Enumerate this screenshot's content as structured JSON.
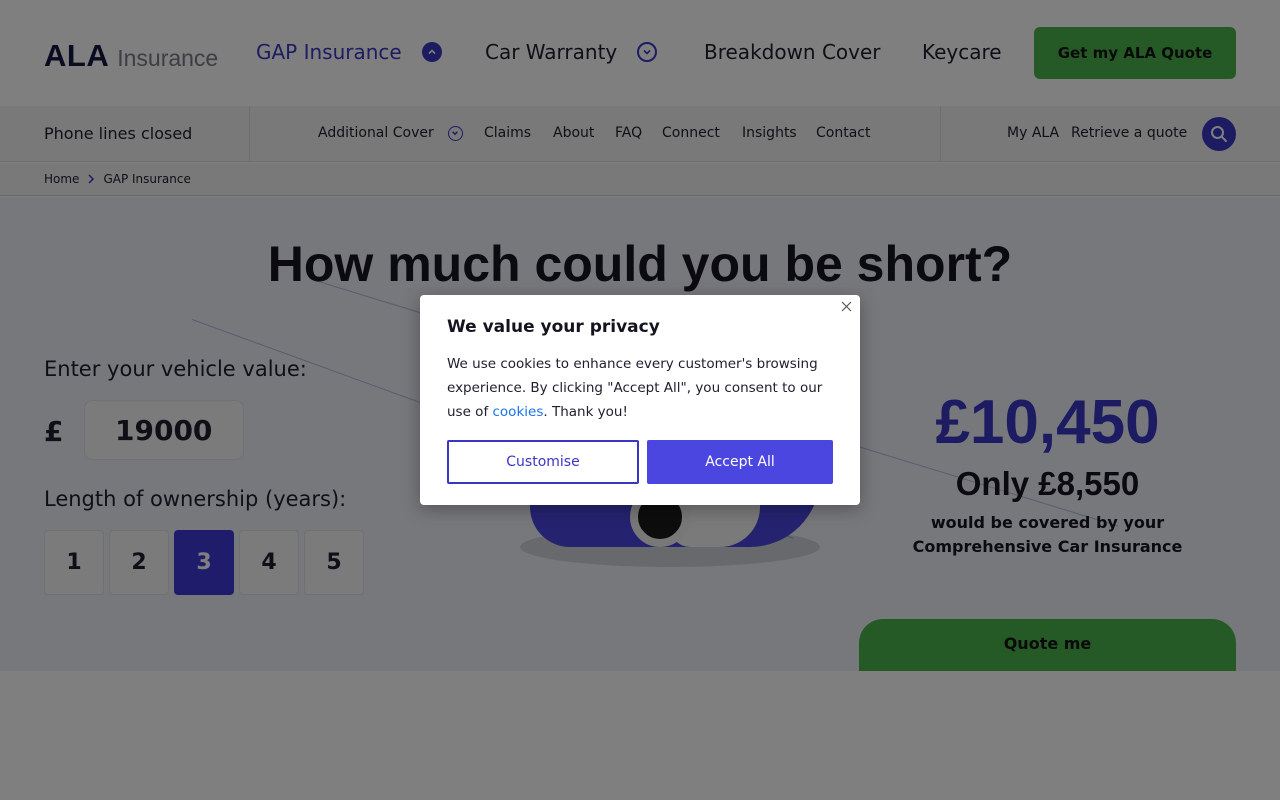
{
  "header": {
    "logo_mark": "ALA",
    "logo_word": "Insurance",
    "nav": [
      {
        "label": "GAP Insurance"
      },
      {
        "label": "Car Warranty"
      },
      {
        "label": "Breakdown Cover"
      },
      {
        "label": "Keycare"
      }
    ],
    "cta_label": "Get my ALA Quote"
  },
  "subnav": {
    "phone_status": "Phone lines closed",
    "items": [
      {
        "label": "Additional Cover"
      },
      {
        "label": "Claims"
      },
      {
        "label": "About"
      },
      {
        "label": "FAQ"
      },
      {
        "label": "Connect"
      },
      {
        "label": "Insights"
      },
      {
        "label": "Contact"
      }
    ],
    "my_ala": "My ALA",
    "retrieve": "Retrieve a quote"
  },
  "breadcrumb": {
    "home": "Home",
    "current": "GAP Insurance"
  },
  "calculator": {
    "title": "How much could you be short?",
    "value_label": "Enter your vehicle value:",
    "currency_symbol": "£",
    "vehicle_value": "19000",
    "ownership_label": "Length of ownership (years):",
    "years": [
      "1",
      "2",
      "3",
      "4",
      "5"
    ],
    "selected_year": "3",
    "shortfall_amount": "£10,450",
    "covered_amount": "Only £8,550",
    "covered_text_1": "would be covered by your",
    "covered_text_2": "Comprehensive Car Insurance",
    "quote_button": "Quote me"
  },
  "cookie_modal": {
    "title": "We value your privacy",
    "body_before_link": "We use cookies to enhance every customer's browsing experience. By clicking \"Accept All\", you consent to our use of ",
    "link_text": "cookies",
    "body_after_link": ". Thank you!",
    "customise_label": "Customise",
    "accept_label": "Accept All"
  },
  "colors": {
    "brand_primary": "#3a36c4",
    "cta_green": "#4bb34b",
    "link_blue": "#1a73e8"
  }
}
